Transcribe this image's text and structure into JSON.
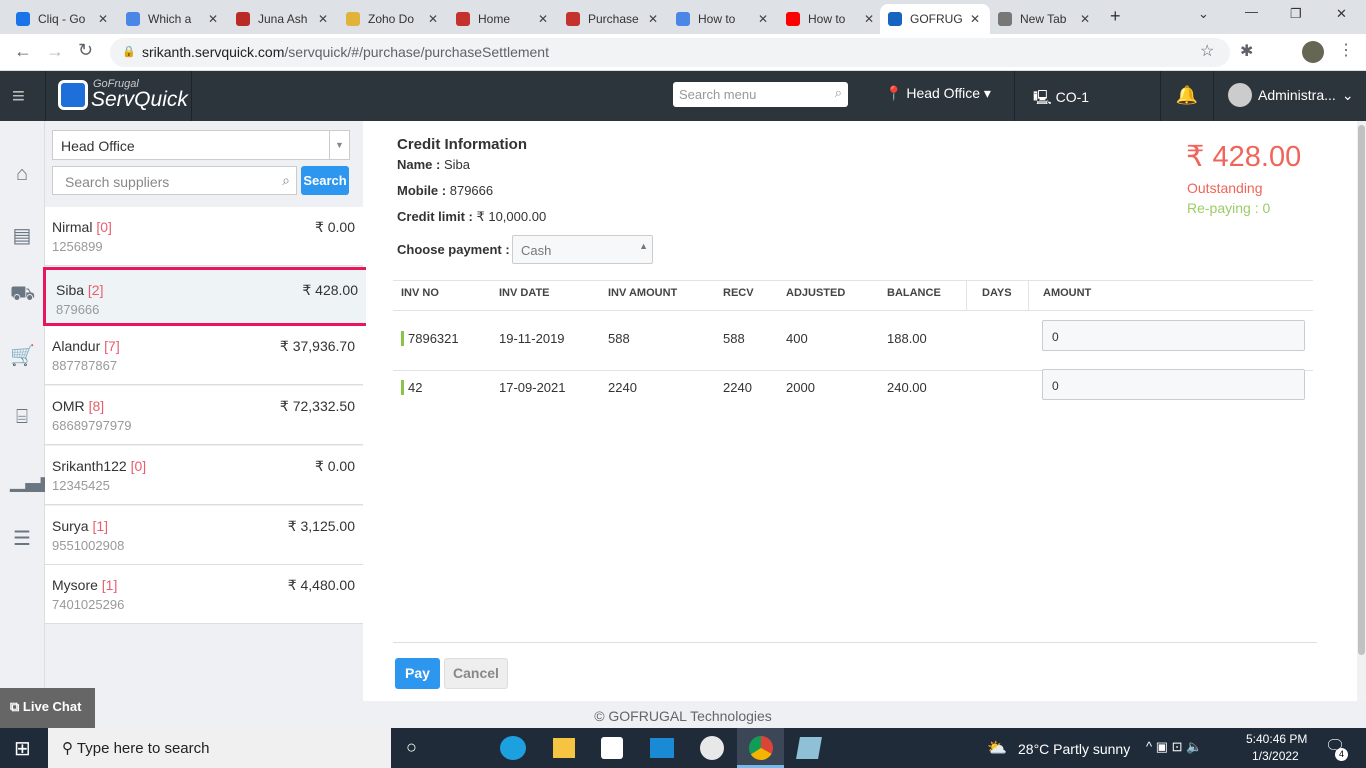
{
  "browser": {
    "tabs": [
      {
        "label": "Cliq - Go",
        "color": "#1a73e8"
      },
      {
        "label": "Which a",
        "color": "#4a86e8"
      },
      {
        "label": "Juna Ash",
        "color": "#b92b27"
      },
      {
        "label": "Zoho Do",
        "color": "#e2b33b"
      },
      {
        "label": "Home",
        "color": "#c5322e"
      },
      {
        "label": "Purchase",
        "color": "#c5322e"
      },
      {
        "label": "How to",
        "color": "#4a86e8"
      },
      {
        "label": "How to",
        "color": "#ff0000"
      },
      {
        "label": "GOFRUG",
        "color": "#1565c0"
      },
      {
        "label": "New Tab",
        "color": "#777"
      }
    ],
    "url_host": "srikanth.servquick.com",
    "url_path": "/servquick/#/purchase/purchaseSettlement"
  },
  "header": {
    "brand_small": "GoFrugal",
    "brand": "ServQuick",
    "search_placeholder": "Search menu",
    "location": "Head Office",
    "counter": "CO-1",
    "user": "Administra..."
  },
  "suppliers": {
    "branch": "Head Office",
    "search_placeholder": "Search suppliers",
    "search_button": "Search",
    "items": [
      {
        "name": "Nirmal",
        "count": "[0]",
        "mobile": "1256899",
        "amount": "₹ 0.00"
      },
      {
        "name": "Siba",
        "count": "[2]",
        "mobile": "879666",
        "amount": "₹ 428.00",
        "selected": true
      },
      {
        "name": "Alandur",
        "count": "[7]",
        "mobile": "887787867",
        "amount": "₹ 37,936.70"
      },
      {
        "name": "OMR",
        "count": "[8]",
        "mobile": "68689797979",
        "amount": "₹ 72,332.50"
      },
      {
        "name": "Srikanth122",
        "count": "[0]",
        "mobile": "12345425",
        "amount": "₹ 0.00"
      },
      {
        "name": "Surya",
        "count": "[1]",
        "mobile": "9551002908",
        "amount": "₹ 3,125.00"
      },
      {
        "name": "Mysore",
        "count": "[1]",
        "mobile": "7401025296",
        "amount": "₹ 4,480.00"
      }
    ]
  },
  "credit": {
    "title": "Credit Information",
    "name_label": "Name :",
    "name": "Siba",
    "mobile_label": "Mobile :",
    "mobile": "879666",
    "limit_label": "Credit limit :",
    "limit": "₹ 10,000.00",
    "payment_label": "Choose payment :",
    "payment": "Cash",
    "outstanding_amount": "₹ 428.00",
    "outstanding_label": "Outstanding",
    "repaying": "Re-paying : 0"
  },
  "table": {
    "headers": [
      "INV NO",
      "INV DATE",
      "INV AMOUNT",
      "RECV",
      "ADJUSTED",
      "BALANCE",
      "DAYS",
      "AMOUNT"
    ],
    "rows": [
      {
        "inv_no": "7896321",
        "date": "19-11-2019",
        "amount": "588",
        "recv": "588",
        "adjusted": "400",
        "balance": "188.00",
        "days": "",
        "pay": "0"
      },
      {
        "inv_no": "42",
        "date": "17-09-2021",
        "amount": "2240",
        "recv": "2240",
        "adjusted": "2000",
        "balance": "240.00",
        "days": "",
        "pay": "0"
      }
    ]
  },
  "actions": {
    "pay": "Pay",
    "cancel": "Cancel"
  },
  "live_chat": "Live Chat",
  "footer": "© GOFRUGAL Technologies",
  "taskbar": {
    "search": "Type here to search",
    "weather": "28°C  Partly sunny",
    "time": "5:40:46 PM",
    "date": "1/3/2022",
    "notifications": "4"
  }
}
